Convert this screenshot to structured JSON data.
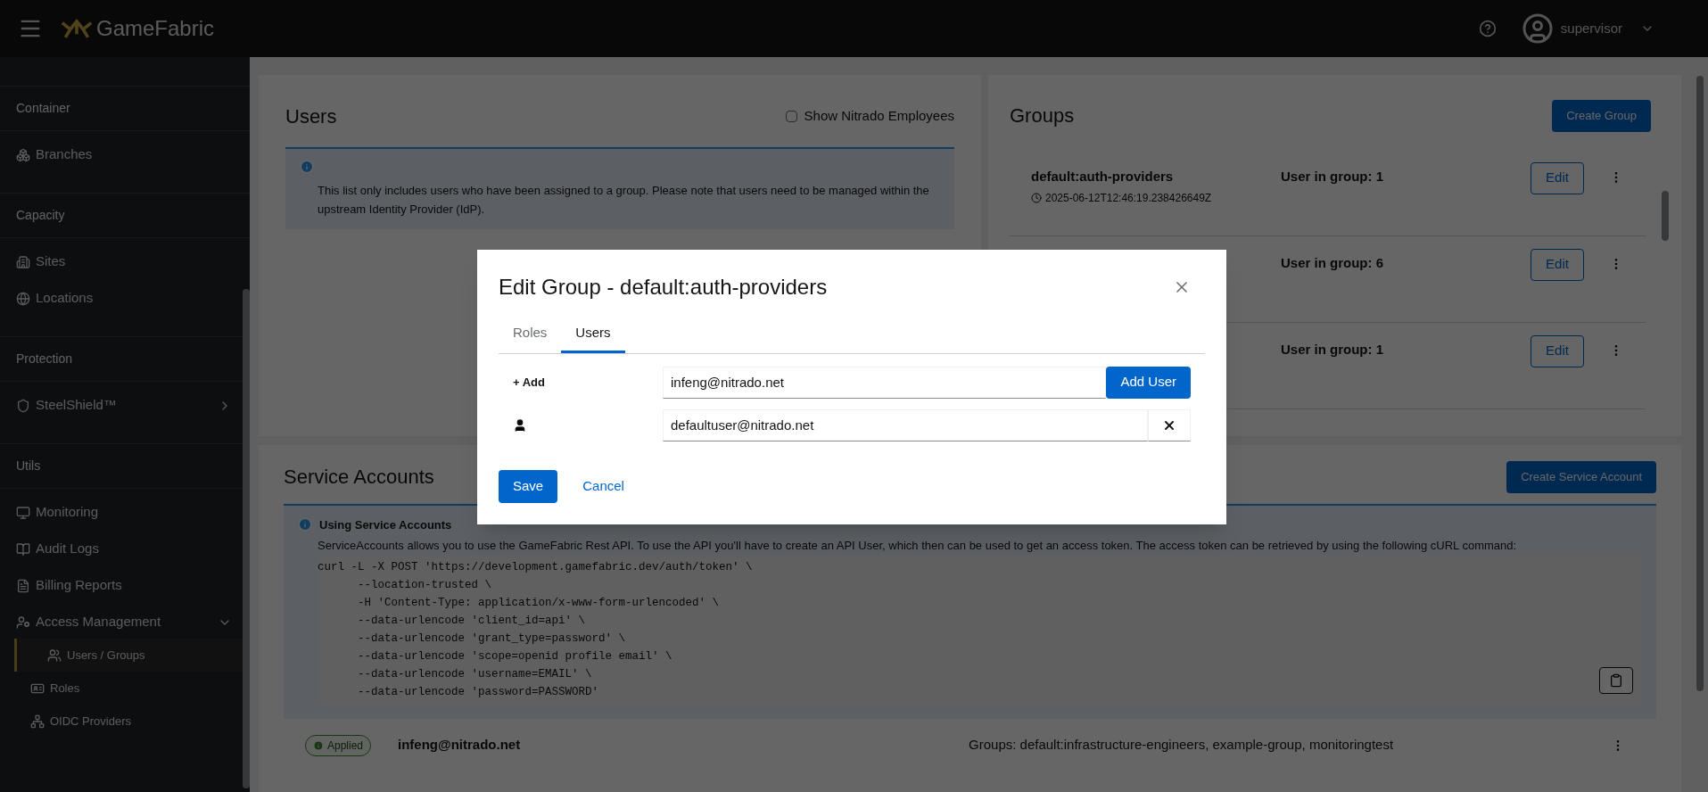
{
  "header": {
    "brand": "GameFabric",
    "username": "supervisor"
  },
  "sidebar": {
    "sections": [
      {
        "title": "Container",
        "items": [
          {
            "label": "Branches",
            "selected": false
          }
        ]
      },
      {
        "title": "Capacity",
        "items": [
          {
            "label": "Sites",
            "selected": false
          },
          {
            "label": "Locations",
            "selected": false
          }
        ]
      },
      {
        "title": "Protection",
        "items": [
          {
            "label": "SteelShield™",
            "selected": false,
            "expanded": false
          }
        ]
      },
      {
        "title": "Utils",
        "items": [
          {
            "label": "Monitoring",
            "selected": false
          },
          {
            "label": "Audit Logs",
            "selected": false
          },
          {
            "label": "Billing Reports",
            "selected": false
          },
          {
            "label": "Access Management",
            "selected": false,
            "expanded": true,
            "children": [
              {
                "label": "Users / Groups",
                "selected": true
              },
              {
                "label": "Roles",
                "selected": false
              },
              {
                "label": "OIDC Providers",
                "selected": false
              }
            ]
          }
        ]
      }
    ]
  },
  "users_panel": {
    "title": "Users",
    "show_employees": {
      "label": "Show Nitrado Employees",
      "checked": false
    },
    "info": "This list only includes users who have been assigned to a group. Please note that users need to be managed within the upstream Identity Provider (IdP)."
  },
  "groups_panel": {
    "title": "Groups",
    "create_button": "Create Group",
    "rows": [
      {
        "name": "default:auth-providers",
        "timestamp": "2025-06-12T12:46:19.238426649Z",
        "count": "User in group: 1",
        "edit": "Edit"
      },
      {
        "count": "User in group: 6",
        "edit": "Edit"
      },
      {
        "count": "User in group: 1",
        "edit": "Edit"
      }
    ]
  },
  "service_accounts": {
    "title": "Service Accounts",
    "create_button": "Create Service Account",
    "info_title": "Using Service Accounts",
    "info_text": "ServiceAccounts allows you to use the GameFabric Rest API. To use the API you'll have to create an API User, which then can be used to get an access token. The access token can be retrieved by using the following cURL command:",
    "code": [
      "curl -L -X POST 'https://development.gamefabric.dev/auth/token' \\",
      "      --location-trusted \\",
      "      -H 'Content-Type: application/x-www-form-urlencoded' \\",
      "      --data-urlencode 'client_id=api' \\",
      "      --data-urlencode 'grant_type=password' \\",
      "      --data-urlencode 'scope=openid profile email' \\",
      "      --data-urlencode 'username=EMAIL' \\",
      "      --data-urlencode 'password=PASSWORD'"
    ],
    "rows": [
      {
        "status": "Applied",
        "email": "infeng@nitrado.net",
        "groups": "Groups: default:infrastructure-engineers, example-group, monitoringtest"
      }
    ]
  },
  "modal": {
    "title": "Edit Group - default:auth-providers",
    "tabs": [
      {
        "label": "Roles",
        "selected": false
      },
      {
        "label": "Users",
        "selected": true
      }
    ],
    "add_label": "+ Add",
    "add_value": "infeng@nitrado.net",
    "add_button": "Add User",
    "members": [
      "defaultuser@nitrado.net"
    ],
    "save": "Save",
    "cancel": "Cancel"
  }
}
